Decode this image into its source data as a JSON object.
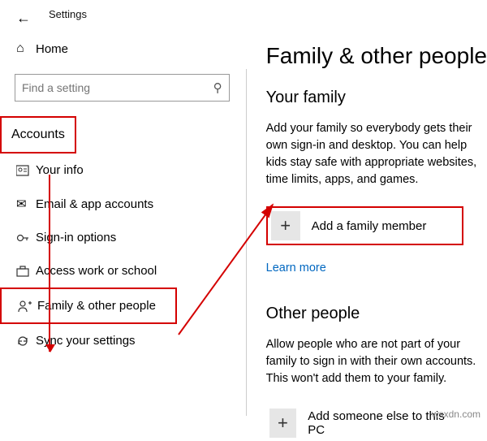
{
  "window": {
    "title": "Settings"
  },
  "sidebar": {
    "home": "Home",
    "search_placeholder": "Find a setting",
    "section": "Accounts",
    "items": [
      {
        "label": "Your info"
      },
      {
        "label": "Email & app accounts"
      },
      {
        "label": "Sign-in options"
      },
      {
        "label": "Access work or school"
      },
      {
        "label": "Family & other people"
      },
      {
        "label": "Sync your settings"
      }
    ]
  },
  "main": {
    "title": "Family & other people",
    "your_family_heading": "Your family",
    "your_family_desc": "Add your family so everybody gets their own sign-in and desktop. You can help kids stay safe with appropriate websites, time limits, apps, and games.",
    "add_family_label": "Add a family member",
    "learn_more": "Learn more",
    "other_people_heading": "Other people",
    "other_people_desc": "Allow people who are not part of your family to sign in with their own accounts. This won't add them to your family.",
    "add_other_label": "Add someone else to this PC"
  },
  "watermark": "wsxdn.com"
}
